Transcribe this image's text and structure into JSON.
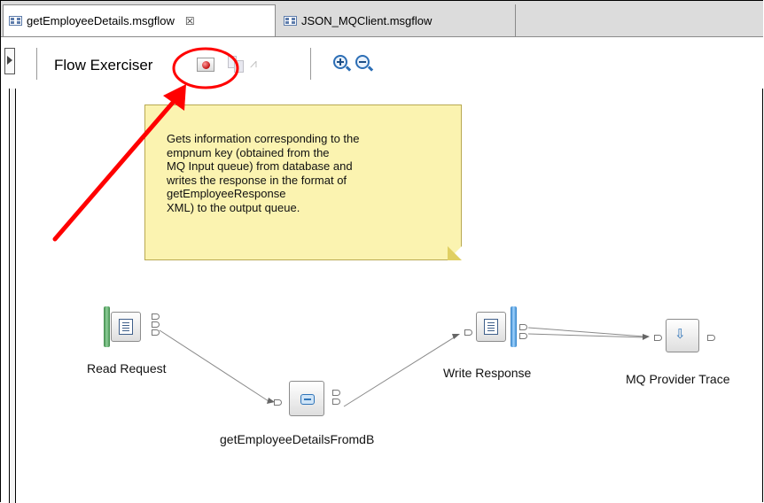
{
  "tabs": [
    {
      "label": "getEmployeeDetails.msgflow",
      "active": true,
      "close_glyph": "☒"
    },
    {
      "label": "JSON_MQClient.msgflow",
      "active": false
    }
  ],
  "toolbar": {
    "title": "Flow Exerciser",
    "icons": [
      "record-icon",
      "view-message-icon",
      "reset-flow-icon",
      "zoom-in-icon",
      "zoom-out-icon"
    ]
  },
  "note": {
    "text": "Gets information corresponding to the\nempnum key (obtained from the\nMQ Input queue) from database and\nwrites the response in the format of\ngetEmployeeResponse\nXML) to the output queue."
  },
  "nodes": [
    {
      "id": "read",
      "label": "Read Request",
      "kind": "mq-input"
    },
    {
      "id": "compute",
      "label": "getEmployeeDetailsFromdB",
      "kind": "compute"
    },
    {
      "id": "write",
      "label": "Write Response",
      "kind": "mq-output"
    },
    {
      "id": "trace",
      "label": "MQ Provider Trace",
      "kind": "trace"
    }
  ],
  "annotation": {
    "highlight_color": "#ff0000"
  },
  "colors": {
    "note_bg": "#fbf3b0",
    "input_bar": "#5fa86a",
    "output_bar": "#4a9fe0"
  }
}
